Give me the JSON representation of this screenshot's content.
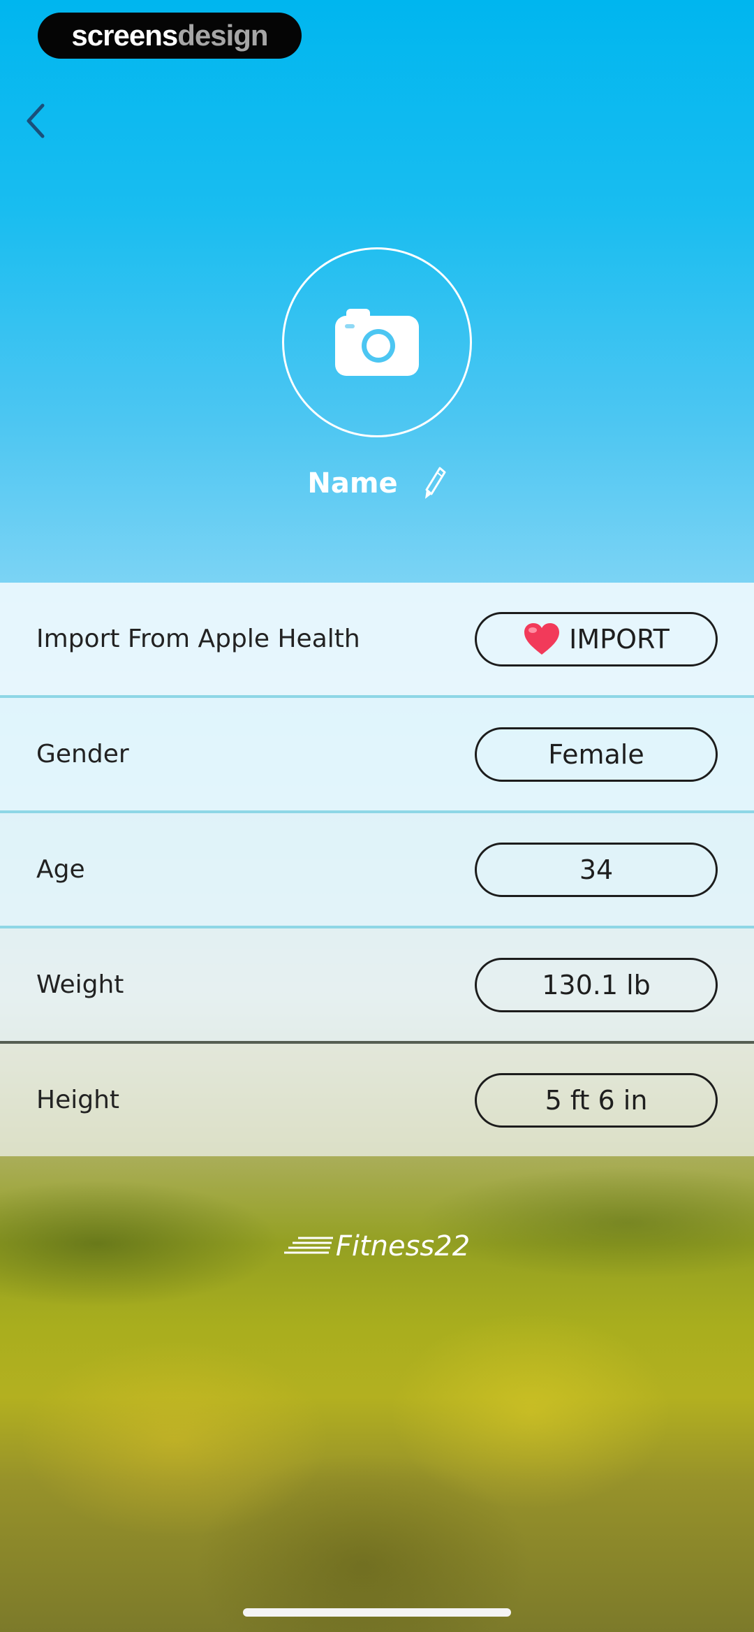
{
  "watermark": {
    "part1": "screens",
    "part2": "design"
  },
  "profile": {
    "name": "Name"
  },
  "rows": [
    {
      "label": "Import From Apple Health",
      "button": "IMPORT"
    },
    {
      "label": "Gender",
      "value": "Female"
    },
    {
      "label": "Age",
      "value": "34"
    },
    {
      "label": "Weight",
      "value": "130.1 lb"
    },
    {
      "label": "Height",
      "value": "5 ft 6 in"
    }
  ],
  "brand": {
    "text": "Fitness22"
  },
  "icons": {
    "back": "chevron-left-icon",
    "avatar": "camera-icon",
    "edit": "pencil-icon",
    "import": "heart-icon",
    "logo": "speed-lines-icon"
  },
  "colors": {
    "sky_top": "#00b6ef",
    "sky_light": "#7ad3f4",
    "divider": "#8ed6e6",
    "pill_border": "#1c1c1c",
    "heart": "#f23a5a"
  }
}
